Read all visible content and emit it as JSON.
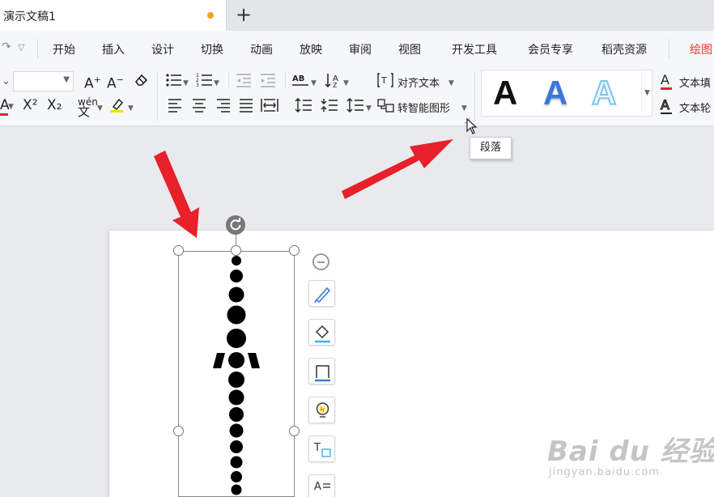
{
  "titlebar": {
    "doc_name": "演示文稿1",
    "new_tab_icon": "plus-icon",
    "unsaved_color": "#f0a020"
  },
  "menu": {
    "items": [
      "开始",
      "插入",
      "设计",
      "切换",
      "动画",
      "放映",
      "审阅",
      "视图",
      "开发工具",
      "会员专享",
      "稻壳资源",
      "绘图"
    ],
    "active_index": 11,
    "active_color": "#e8382c"
  },
  "ribbon": {
    "font_name_value": "",
    "increase_font_glyph": "A⁺",
    "decrease_font_glyph": "A⁻",
    "clear_format_icon": "eraser-icon",
    "superscript": "X²",
    "subscript": "X₂",
    "phonetic": "wén",
    "align_text_label": "对齐文本",
    "smartart_label": "转智能图形",
    "text_fill_label": "文本填",
    "text_outline_label": "文本轮",
    "style_glyph": "A",
    "style_colors": [
      "#111111",
      "#3a78d8",
      "#7cc6ee"
    ]
  },
  "tooltip": {
    "text": "段落"
  },
  "float_tools": [
    "brush-icon",
    "fill-bucket-icon",
    "outline-icon",
    "lightbulb-icon",
    "text-frame-icon",
    "text-select-icon"
  ],
  "annotation_color": "#e8202a",
  "watermark": {
    "brand": "Bai du 经验",
    "url": "jingyan.baidu.com"
  }
}
